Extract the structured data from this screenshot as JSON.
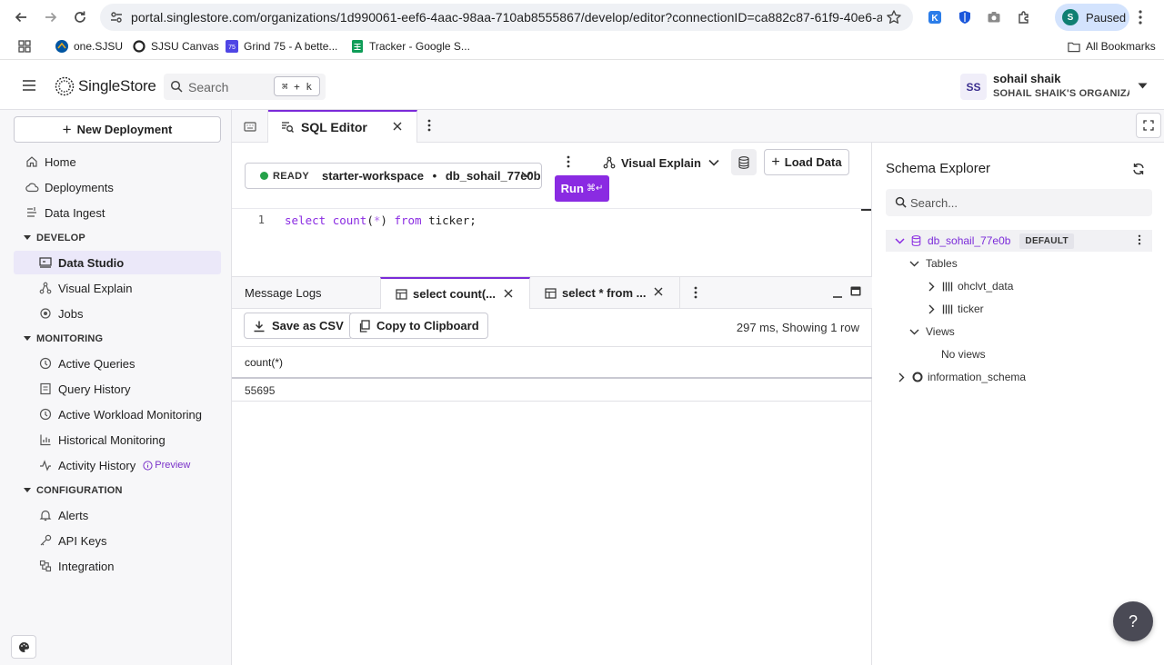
{
  "browser": {
    "url": "portal.singlestore.com/organizations/1d990061-eef6-4aac-98aa-710ab8555867/develop/editor?connectionID=ca882c87-61f9-40e6-aa...",
    "profile_initial": "S",
    "profile_status": "Paused",
    "bookmarks": [
      {
        "label": "one.SJSU"
      },
      {
        "label": "SJSU Canvas"
      },
      {
        "label": "Grind 75 - A bette..."
      },
      {
        "label": "Tracker - Google S..."
      }
    ],
    "all_bookmarks": "All Bookmarks"
  },
  "header": {
    "logo_text": "SingleStore",
    "search_placeholder": "Search",
    "search_shortcut": "⌘ + k",
    "user": {
      "initials": "SS",
      "name": "sohail shaik",
      "org": "SOHAIL SHAIK'S ORGANIZA..."
    }
  },
  "sidebar": {
    "new_deployment": "New Deployment",
    "top_items": [
      {
        "label": "Home",
        "icon": "home-icon"
      },
      {
        "label": "Deployments",
        "icon": "cloud-icon"
      },
      {
        "label": "Data Ingest",
        "icon": "ingest-icon"
      }
    ],
    "sections": [
      {
        "title": "DEVELOP",
        "items": [
          {
            "label": "Data Studio",
            "icon": "studio-icon",
            "active": true
          },
          {
            "label": "Visual Explain",
            "icon": "graph-icon"
          },
          {
            "label": "Jobs",
            "icon": "jobs-icon"
          }
        ]
      },
      {
        "title": "MONITORING",
        "items": [
          {
            "label": "Active Queries",
            "icon": "clock-icon"
          },
          {
            "label": "Query History",
            "icon": "history-icon"
          },
          {
            "label": "Active Workload Monitoring",
            "icon": "clock-icon"
          },
          {
            "label": "Historical Monitoring",
            "icon": "chart-icon"
          },
          {
            "label": "Activity History",
            "icon": "activity-icon",
            "badge": "Preview"
          }
        ]
      },
      {
        "title": "CONFIGURATION",
        "items": [
          {
            "label": "Alerts",
            "icon": "bell-icon"
          },
          {
            "label": "API Keys",
            "icon": "key-icon"
          },
          {
            "label": "Integration",
            "icon": "integration-icon"
          }
        ]
      }
    ]
  },
  "editor": {
    "tab_label": "SQL Editor",
    "status": "READY",
    "workspace": "starter-workspace",
    "separator": "•",
    "database": "db_sohail_77e0b",
    "run_label": "Run",
    "run_shortcut": "⌘↵",
    "visual_explain": "Visual Explain",
    "load_data": "Load Data",
    "code_lines": [
      {
        "number": "1",
        "text": "select count(*) from ticker;"
      }
    ]
  },
  "results": {
    "tabs": [
      {
        "label": "Message Logs"
      },
      {
        "label": "select count(..."
      },
      {
        "label": "select * from ..."
      }
    ],
    "save_csv": "Save as CSV",
    "copy_clipboard": "Copy to Clipboard",
    "stats": "297 ms, Showing 1 row",
    "columns": [
      "count(*)"
    ],
    "rows": [
      [
        "55695"
      ]
    ]
  },
  "schema": {
    "title": "Schema Explorer",
    "search_placeholder": "Search...",
    "db_name": "db_sohail_77e0b",
    "db_badge": "DEFAULT",
    "tables_label": "Tables",
    "tables": [
      "ohclvt_data",
      "ticker"
    ],
    "views_label": "Views",
    "no_views": "No views",
    "other_db": "information_schema"
  },
  "colors": {
    "accent": "#8a2be2",
    "ready": "#24a148"
  }
}
